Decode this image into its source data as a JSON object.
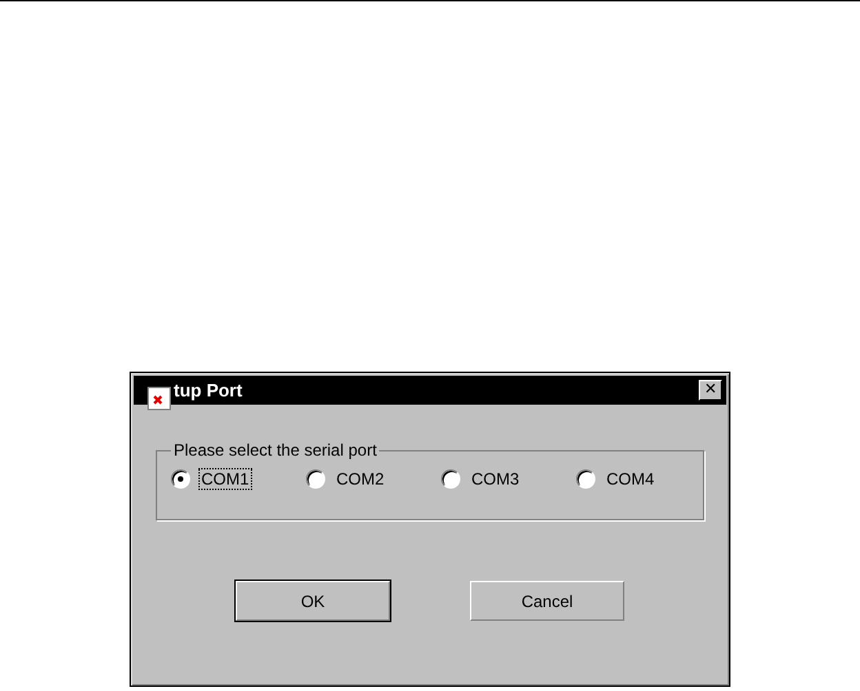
{
  "window": {
    "title": "tup Port",
    "close": "✕"
  },
  "group": {
    "label": "Please select the serial port",
    "options": [
      {
        "label": "COM1",
        "selected": true
      },
      {
        "label": "COM2",
        "selected": false
      },
      {
        "label": "COM3",
        "selected": false
      },
      {
        "label": "COM4",
        "selected": false
      }
    ]
  },
  "buttons": [
    {
      "label": "OK",
      "default": true
    },
    {
      "label": "Cancel",
      "default": false
    }
  ]
}
